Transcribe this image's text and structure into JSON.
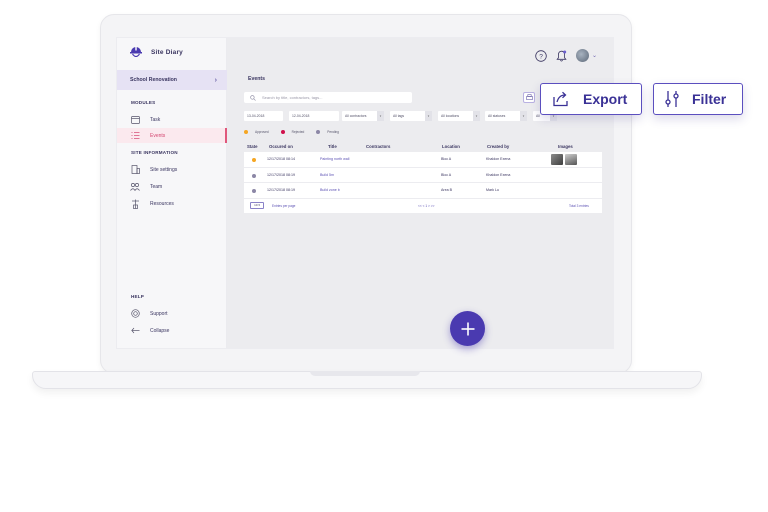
{
  "app": {
    "brand_name": "Site Diary",
    "project_name": "School Renovation"
  },
  "sidebar": {
    "modules_label": "MODULES",
    "modules": [
      {
        "label": "Task",
        "icon": "calendar-icon"
      },
      {
        "label": "Events",
        "icon": "list-icon",
        "active": true
      }
    ],
    "site_info_label": "SITE INFORMATION",
    "site_info": [
      {
        "label": "Site settings",
        "icon": "building-icon"
      },
      {
        "label": "Team",
        "icon": "team-icon"
      },
      {
        "label": "Resources",
        "icon": "crane-icon"
      }
    ],
    "help_label": "HELP",
    "help": [
      {
        "label": "Support",
        "icon": "lifebuoy-icon"
      },
      {
        "label": "Collapse",
        "icon": "arrow-left-icon"
      }
    ]
  },
  "header": {
    "icons": [
      "help-icon",
      "notification-bell-icon",
      "user-avatar"
    ]
  },
  "events": {
    "title": "Events",
    "search_placeholder": "Search by title, contractors, tags...",
    "filters": {
      "date_from": "13-04-2018",
      "date_to": "12-04-2018",
      "contractors": "All contractors",
      "tags": "All tags",
      "locations": "All locations",
      "statuses": "All statuses",
      "last": "All"
    },
    "legend": [
      {
        "label": "Approved",
        "color": "#f5a623"
      },
      {
        "label": "Rejected",
        "color": "#d0104c"
      },
      {
        "label": "Pending",
        "color": "#8c87a6"
      }
    ],
    "columns": [
      "State",
      "Occured on",
      "Title",
      "Contractors",
      "Location",
      "Created by",
      "Images"
    ],
    "rows": [
      {
        "state_color": "#f5a623",
        "occured_on": "12/17/2018 08:14",
        "title": "Painting north wall",
        "contractors": "",
        "location": "Bloc A",
        "created_by": "Khaldon Exena",
        "images": 2
      },
      {
        "state_color": "#8c87a6",
        "occured_on": "12/17/2018 08:19",
        "title": "Build 5m",
        "contractors": "",
        "location": "Bloc A",
        "created_by": "Khaldon Exena",
        "images": 0
      },
      {
        "state_color": "#8c87a6",
        "occured_on": "12/17/2018 08:19",
        "title": "Build zone b",
        "contractors": "",
        "location": "Area B",
        "created_by": "Mark Lu",
        "images": 0
      }
    ],
    "footer": {
      "per_page_value": "10",
      "per_page_label": "Entries per page",
      "pagination": "<< < 1 > >>",
      "total": "Total 3 entries"
    }
  },
  "callouts": {
    "export_label": "Export",
    "filter_label": "Filter"
  },
  "colors": {
    "accent": "#4a3ab0",
    "active_nav": "#d44670",
    "project_bg": "#e6e2f4"
  }
}
